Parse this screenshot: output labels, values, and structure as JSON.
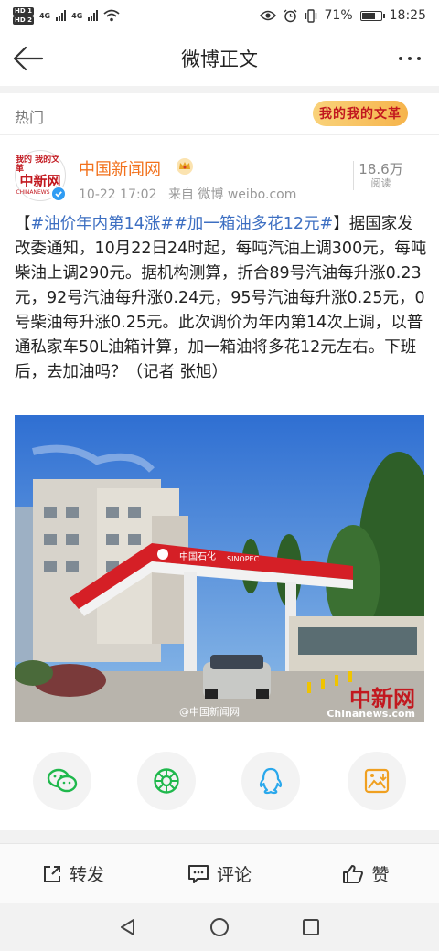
{
  "status_bar": {
    "hd1": "HD 1",
    "hd2": "HD 2",
    "net1": "4G",
    "net2": "4G",
    "battery_percent": "71%",
    "battery_level": 0.71,
    "time": "18:25"
  },
  "navbar": {
    "title": "微博正文"
  },
  "card": {
    "section_label": "热门",
    "badge_text": "我的我的文革",
    "author": {
      "avatar_line1": "我的 我的文革",
      "avatar_logo": "中新网",
      "avatar_site": "CHINANEWS.COM",
      "name": "中国新闻网",
      "time": "10-22 17:02",
      "source": "来自 微博 weibo.com"
    },
    "reads": {
      "count": "18.6万",
      "label": "阅读"
    },
    "post": {
      "open_bracket": "【",
      "tag1": "#油价年内第14涨#",
      "tag2": "#加一箱油多花12元#",
      "close_bracket": "】",
      "body": "据国家发改委通知，10月22日24时起，每吨汽油上调300元，每吨柴油上调290元。据机构测算，折合89号汽油每升涨0.23元，92号汽油每升涨0.24元，95号汽油每升涨0.25元，0号柴油每升涨0.25元。此次调价为年内第14次上调，以普通私家车50L油箱计算，加一箱油将多花12元左右。下班后，去加油吗？（记者 张旭）"
    },
    "photo": {
      "station_sign_cn": "中国石化",
      "station_sign_en": "SINOPEC",
      "watermark_weibo": "@中国新闻网",
      "watermark_logo": "中新网",
      "watermark_site": "Chinanews.com"
    }
  },
  "actions": {
    "repost": "转发",
    "comment": "评论",
    "like": "赞"
  }
}
